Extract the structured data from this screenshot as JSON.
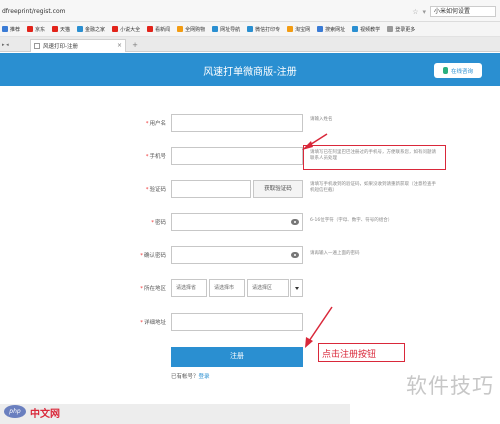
{
  "browser": {
    "url": "dfreeprint/regist.com",
    "search_text": "小米如何设置",
    "bookmarks": [
      {
        "label": "推荐",
        "color": "#3a7bd5"
      },
      {
        "label": "京东",
        "color": "#e2231a"
      },
      {
        "label": "天猫",
        "color": "#e2231a"
      },
      {
        "label": "金融之家",
        "color": "#2a8fd1"
      },
      {
        "label": "小说大全",
        "color": "#e2231a"
      },
      {
        "label": "看新闻",
        "color": "#e2231a"
      },
      {
        "label": "全网购物",
        "color": "#f39c12"
      },
      {
        "label": "网址导航",
        "color": "#2a8fd1"
      },
      {
        "label": "微信打印专",
        "color": "#2a8fd1"
      },
      {
        "label": "淘宝网",
        "color": "#f39c12"
      },
      {
        "label": "搜索网址",
        "color": "#3a7bd5"
      },
      {
        "label": "视频教学",
        "color": "#2a8fd1"
      },
      {
        "label": "登录更多",
        "color": "#999999"
      }
    ],
    "tabs": {
      "active_label": "风速打印-注册",
      "close_glyph": "×",
      "new_glyph": "+"
    }
  },
  "header": {
    "title": "风速打单微商版-注册",
    "contact_label": "在线咨询"
  },
  "form": {
    "username": {
      "label": "用户名",
      "hint": "请输入姓名"
    },
    "phone": {
      "label": "手机号",
      "hint": "请填写已在阿里巴巴注册过的手机号，方便联系您，如有问题请联系人员处理"
    },
    "captcha": {
      "label": "验证码",
      "button": "获取验证码",
      "hint": "请填写手机收到的验证码，如果没收到请重新获取（注意检查手机短信拦截）"
    },
    "password": {
      "label": "密码",
      "hint": "6-16位字符（字母、数字、符号的组合）"
    },
    "confirm": {
      "label": "确认密码",
      "hint": "请再输入一遍上面的密码"
    },
    "region": {
      "label": "所在地区",
      "province": "请选择省",
      "city": "请选择市",
      "district": "请选择区"
    },
    "address": {
      "label": "详细地址"
    },
    "required_mark": "*",
    "submit_label": "注册",
    "login_prompt": "已有帐号？",
    "login_link": "登录"
  },
  "annotation": {
    "text": "点击注册按钮"
  },
  "watermark": {
    "right": "软件技巧",
    "php": "php",
    "cn": "中文网"
  }
}
